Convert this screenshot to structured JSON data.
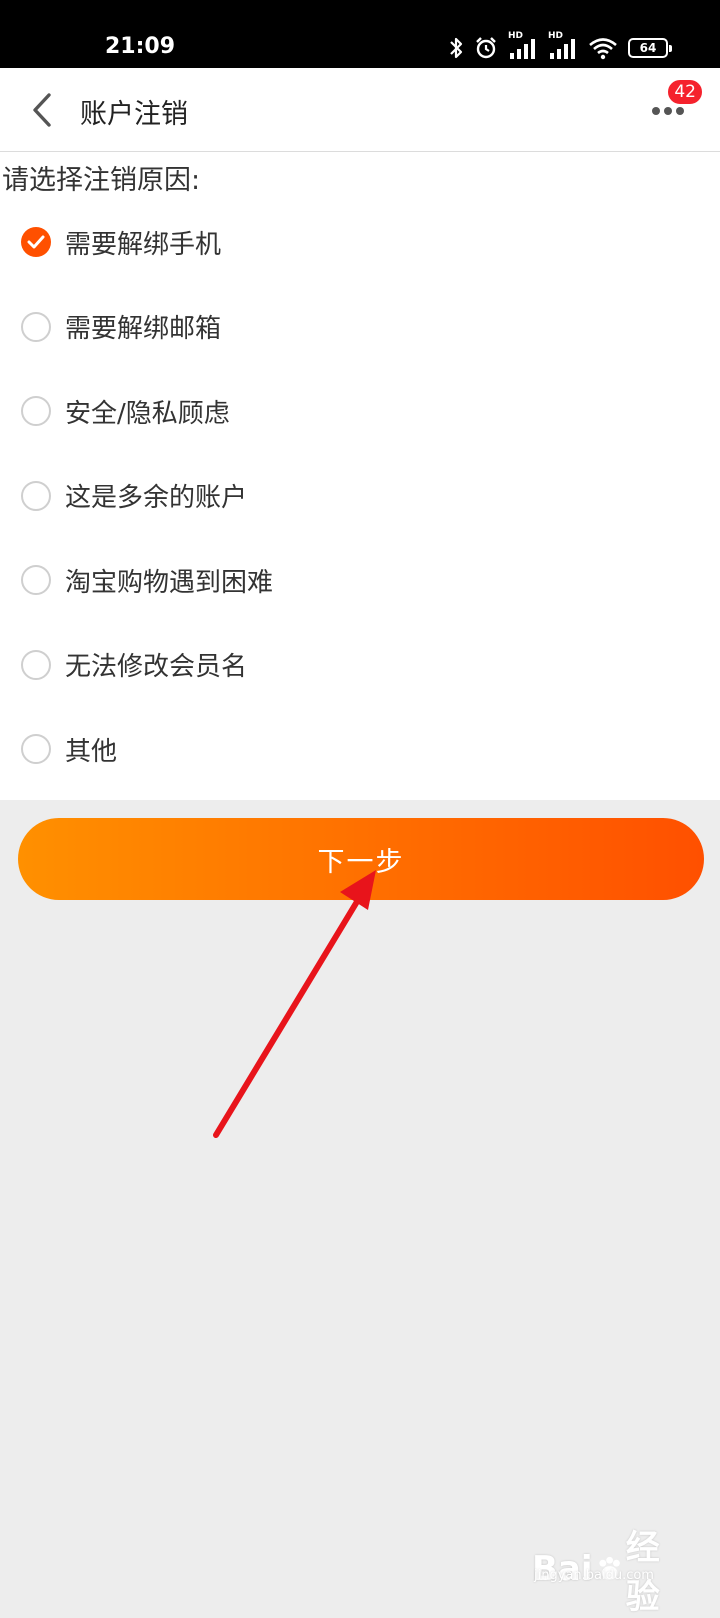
{
  "status_bar": {
    "time": "21:09",
    "hd_label": "HD",
    "battery_level": "64",
    "icons": [
      "bluetooth-icon",
      "alarm-icon",
      "signal-icon",
      "signal-icon",
      "wifi-icon",
      "battery-icon"
    ]
  },
  "nav": {
    "title": "账户注销",
    "back_icon": "chevron-left-icon",
    "more_icon": "more-dots-icon",
    "badge_count": "42"
  },
  "form": {
    "prompt": "请选择注销原因:",
    "selected_index": 0,
    "options": [
      {
        "label": "需要解绑手机",
        "checked": true
      },
      {
        "label": "需要解绑邮箱",
        "checked": false
      },
      {
        "label": "安全/隐私顾虑",
        "checked": false
      },
      {
        "label": "这是多余的账户",
        "checked": false
      },
      {
        "label": "淘宝购物遇到困难",
        "checked": false
      },
      {
        "label": "无法修改会员名",
        "checked": false
      },
      {
        "label": "其他",
        "checked": false
      }
    ]
  },
  "actions": {
    "next_label": "下一步"
  },
  "watermark": {
    "logo_left": "Bai",
    "logo_right": "经验",
    "url": "jingyan.baidu.com"
  },
  "colors": {
    "accent": "#ff5000",
    "gradient_start": "#ff9000",
    "gradient_end": "#ff5000",
    "badge": "#f5222d",
    "annotation_arrow": "#e8141b"
  }
}
